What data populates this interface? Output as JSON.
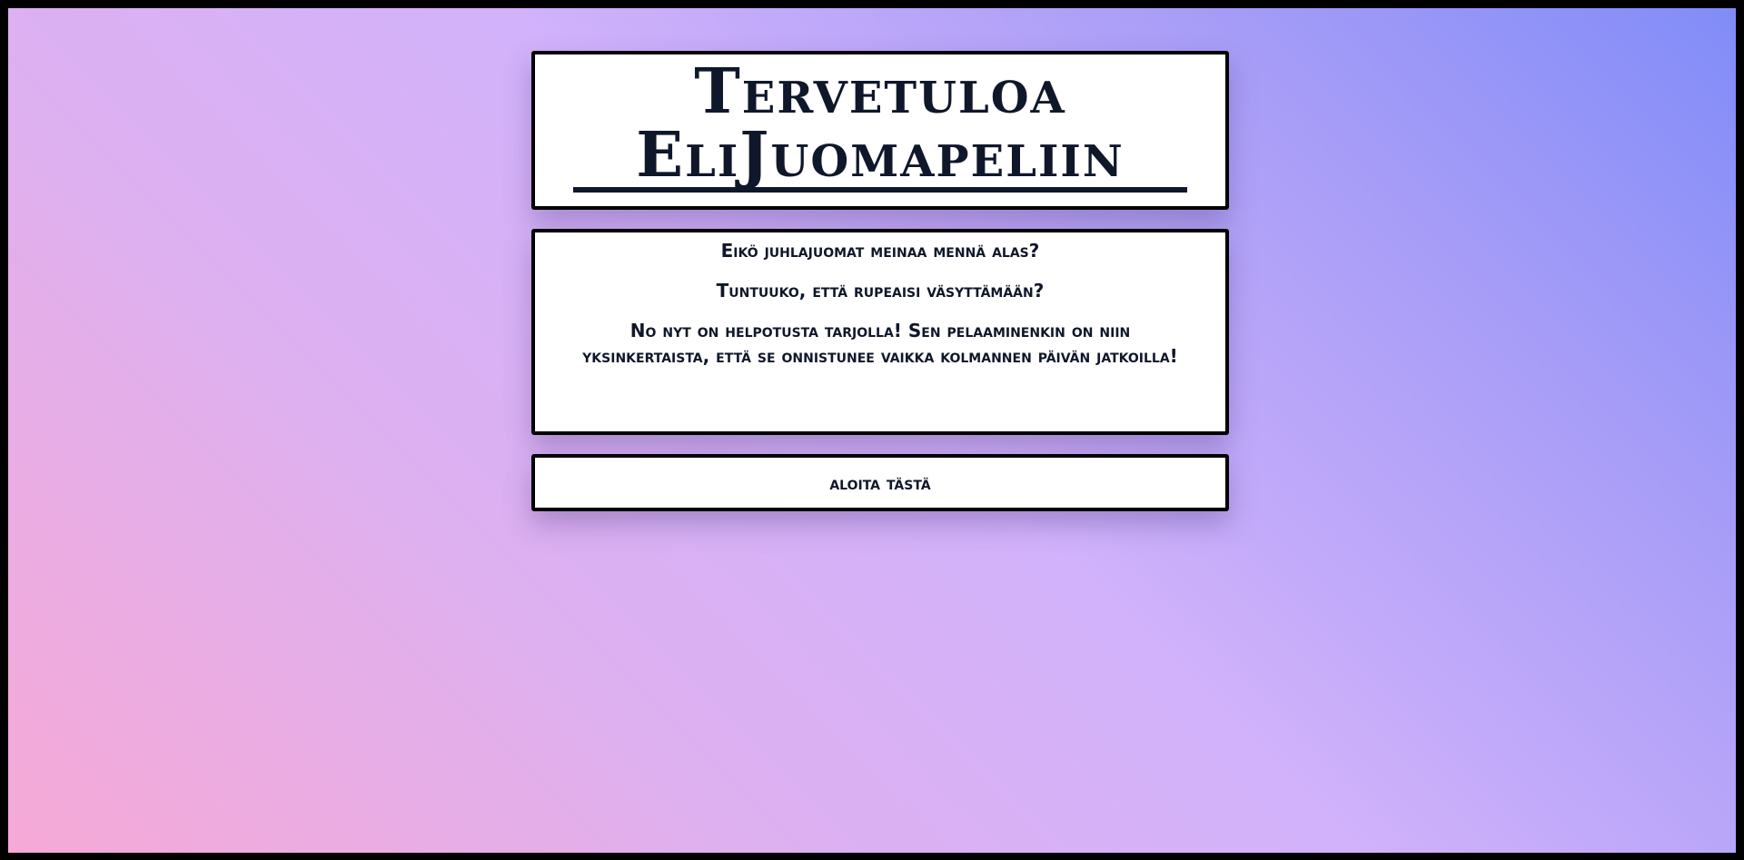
{
  "header": {
    "title_line1": "Tervetuloa",
    "title_line2": "EliJuomapeliin"
  },
  "intro": {
    "line1": "Eikö juhlajuomat meinaa mennä alas?",
    "line2": "Tuntuuko, että rupeaisi väsyttämään?",
    "line3": "No nyt on helpotusta tarjolla! Sen pelaaminenkin on niin yksinkertaista, että se onnistunee vaikka kolmannen päivän jatkoilla!"
  },
  "start_button": {
    "label": "aloita tästä"
  },
  "colors": {
    "gradient_top_right": "#818cf8",
    "gradient_middle": "#d2b2fb",
    "gradient_bottom_left": "#f6a9d6",
    "text": "#0f172a",
    "card_border": "#000000"
  }
}
